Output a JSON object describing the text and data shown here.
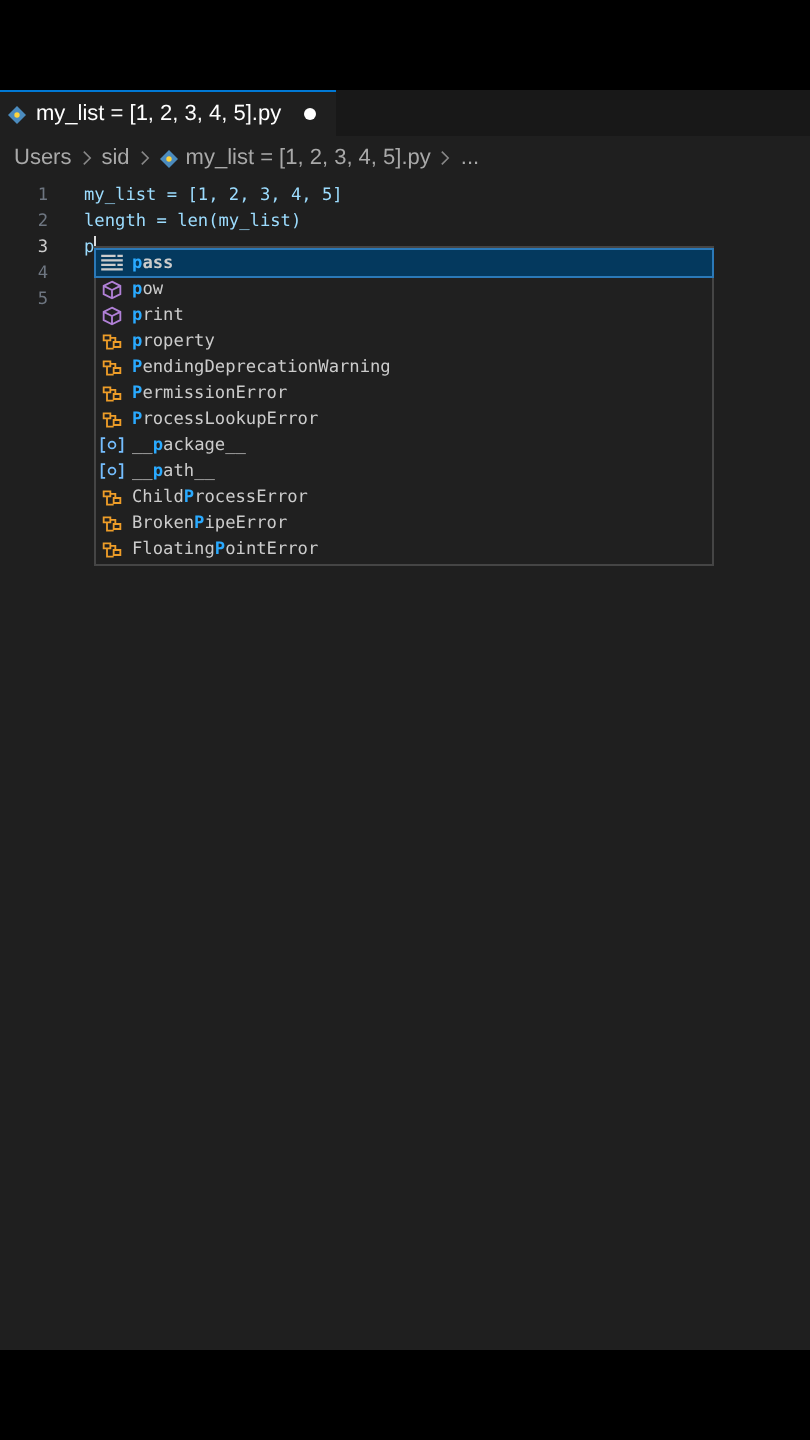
{
  "tab": {
    "title": "my_list = [1, 2, 3, 4, 5].py",
    "modified": true
  },
  "breadcrumbs": [
    "Users",
    "sid",
    "my_list = [1, 2, 3, 4, 5].py",
    "..."
  ],
  "lines": [
    {
      "number": "1",
      "code": "my_list = [1, 2, 3, 4, 5]",
      "current": false
    },
    {
      "number": "2",
      "code": "length = len(my_list)",
      "current": false
    },
    {
      "number": "3",
      "code": "p",
      "current": true
    },
    {
      "number": "4",
      "current": false
    },
    {
      "number": "5",
      "current": false
    }
  ],
  "suggestions": [
    {
      "kind": "keyword",
      "match": "p",
      "after": "ass",
      "selected": true
    },
    {
      "kind": "function",
      "match": "p",
      "after": "ow",
      "selected": false
    },
    {
      "kind": "function",
      "match": "p",
      "after": "rint",
      "selected": false
    },
    {
      "kind": "class",
      "match": "p",
      "after": "roperty",
      "selected": false
    },
    {
      "kind": "class",
      "match": "P",
      "after": "endingDeprecationWarning",
      "selected": false
    },
    {
      "kind": "class",
      "match": "P",
      "after": "ermissionError",
      "selected": false
    },
    {
      "kind": "class",
      "match": "P",
      "after": "rocessLookupError",
      "selected": false
    },
    {
      "kind": "variable",
      "before": "__",
      "match": "p",
      "after": "ackage__",
      "selected": false
    },
    {
      "kind": "variable",
      "before": "__",
      "match": "p",
      "after": "ath__",
      "selected": false
    },
    {
      "kind": "class",
      "before": "Child",
      "match": "P",
      "after": "rocessError",
      "selected": false
    },
    {
      "kind": "class",
      "before": "Broken",
      "match": "P",
      "after": "ipeError",
      "selected": false
    },
    {
      "kind": "class",
      "before": "Floating",
      "match": "P",
      "after": "ointError",
      "selected": false
    }
  ]
}
